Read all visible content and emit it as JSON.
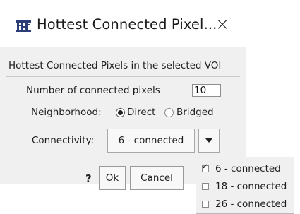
{
  "window": {
    "title": "Hottest Connected Pixel...",
    "app_icon": "pmod-app-icon",
    "close_icon": "close-icon",
    "close_glyph": "×"
  },
  "description": "Hottest Connected Pixels in the selected VOI",
  "pixels": {
    "label": "Number of connected pixels",
    "value": "10"
  },
  "neighborhood": {
    "label": "Neighborhood:",
    "options": [
      {
        "label": "Direct",
        "selected": true
      },
      {
        "label": "Bridged",
        "selected": false
      }
    ]
  },
  "connectivity": {
    "label": "Connectivity:",
    "selected": "6 - connected",
    "arrow_icon": "triangle-down-icon",
    "options": [
      {
        "label": "6 - connected",
        "checked": true
      },
      {
        "label": "18 - connected",
        "checked": false
      },
      {
        "label": "26 - connected",
        "checked": false
      }
    ]
  },
  "buttons": {
    "help": "?",
    "ok_mnemonic": "O",
    "ok_rest": "k",
    "cancel_mnemonic": "C",
    "cancel_rest": "ancel"
  },
  "colors": {
    "dialog_bg": "#f0f0f0",
    "titlebar_bg": "#ffffff",
    "app_icon": "#2c3e78"
  }
}
